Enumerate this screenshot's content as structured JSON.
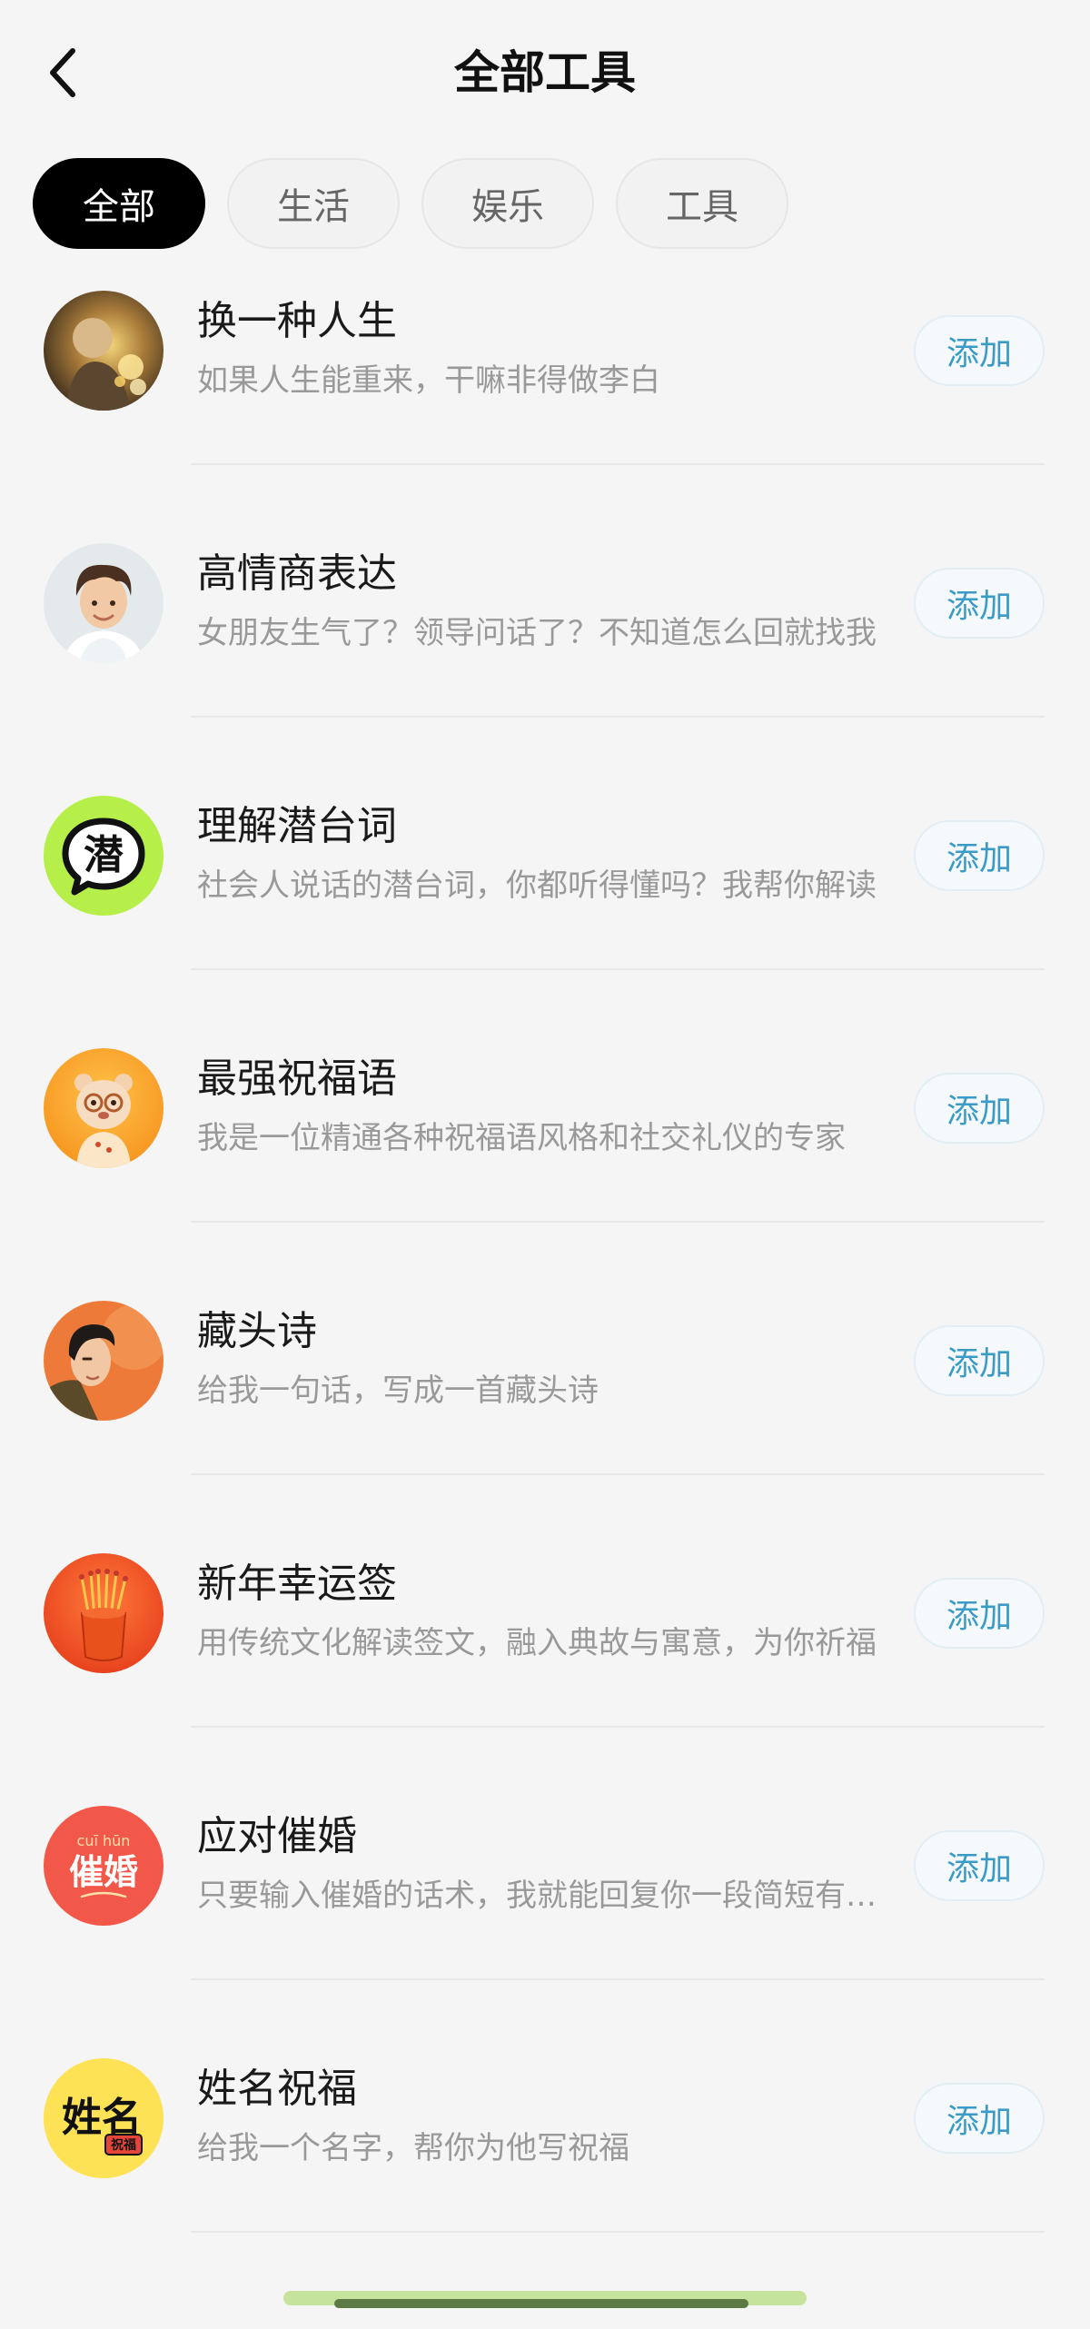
{
  "header": {
    "title": "全部工具",
    "back_icon": "chevron-left-icon"
  },
  "tabs": [
    {
      "label": "全部",
      "active": true
    },
    {
      "label": "生活",
      "active": false
    },
    {
      "label": "娱乐",
      "active": false
    },
    {
      "label": "工具",
      "active": false
    }
  ],
  "items": [
    {
      "title": "换一种人生",
      "desc": "如果人生能重来，干嘛非得做李白",
      "action": "添加",
      "avatar": "golden-portrait-avatar"
    },
    {
      "title": "高情商表达",
      "desc": "女朋友生气了？领导问话了？不知道怎么回就找我",
      "action": "添加",
      "avatar": "smiling-boy-avatar"
    },
    {
      "title": "理解潜台词",
      "desc": "社会人说话的潜台词，你都听得懂吗？我帮你解读",
      "action": "添加",
      "avatar": "speech-bubble-avatar",
      "avatar_text": "潜"
    },
    {
      "title": "最强祝福语",
      "desc": "我是一位精通各种祝福语风格和社交礼仪的专家",
      "action": "添加",
      "avatar": "bear-mascot-avatar"
    },
    {
      "title": "藏头诗",
      "desc": "给我一句话，写成一首藏头诗",
      "action": "添加",
      "avatar": "poet-portrait-avatar"
    },
    {
      "title": "新年幸运签",
      "desc": "用传统文化解读签文，融入典故与寓意，为你祈福",
      "action": "添加",
      "avatar": "fortune-sticks-avatar"
    },
    {
      "title": "应对催婚",
      "desc": "只要输入催婚的话术，我就能回复你一段简短有力的话",
      "action": "添加",
      "avatar": "cuihun-text-avatar",
      "avatar_text": "催婚",
      "avatar_pinyin": "cuī hūn"
    },
    {
      "title": "姓名祝福",
      "desc": "给我一个名字，帮你为他写祝福",
      "action": "添加",
      "avatar": "name-blessing-avatar",
      "avatar_text": "姓名",
      "avatar_badge": "祝福"
    }
  ],
  "colors": {
    "accent": "#3a9bc7",
    "active_tab_bg": "#000000",
    "background": "#f5f5f5"
  }
}
